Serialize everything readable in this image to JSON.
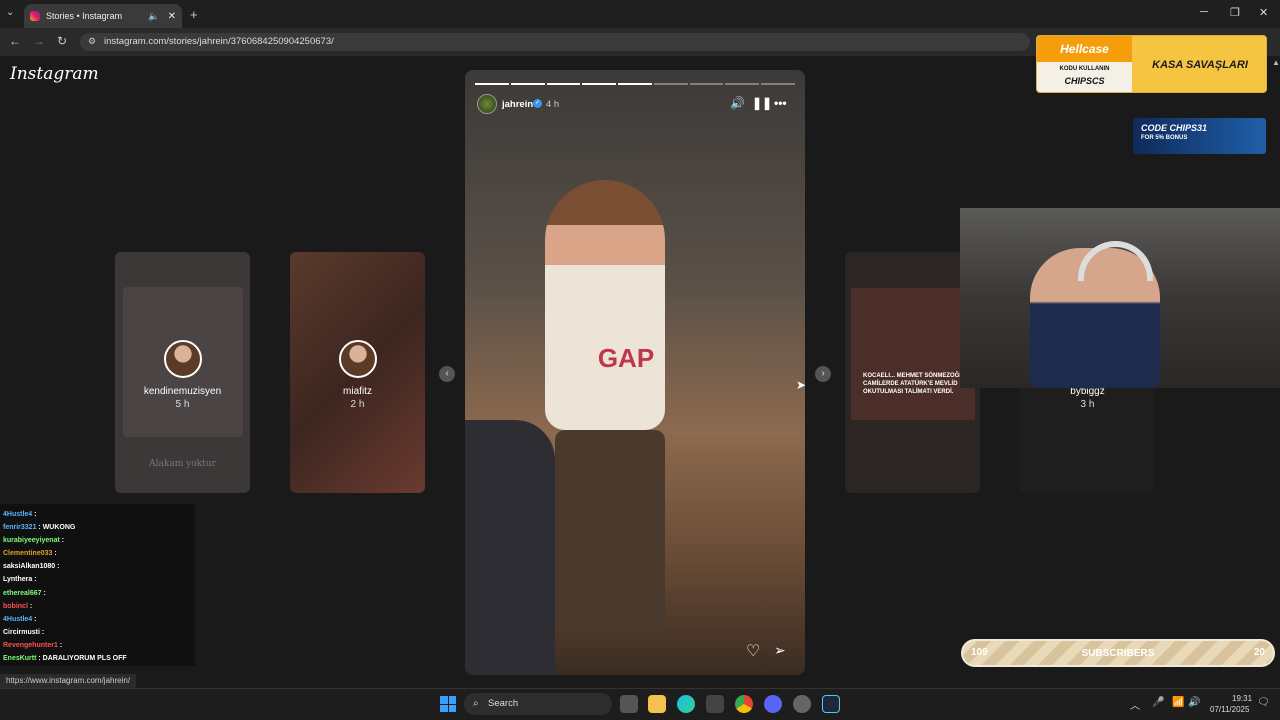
{
  "browser": {
    "tab_title": "Stories • Instagram",
    "url": "instagram.com/stories/jahrein/3760684250904250673/",
    "status_url": "https://www.instagram.com/jahrein/"
  },
  "instagram": {
    "logo": "Instagram",
    "side_stories": [
      {
        "user": "kendinemuzisyen",
        "time": "5 h",
        "caption": "Alakam yoktur"
      },
      {
        "user": "miafitz",
        "time": "2 h"
      },
      {
        "user": "",
        "time": "",
        "caption": "KOCAELI... MEHMET SÖNMEZOĞLU CAMİLERDE ATATÜRK'E MEVLİD OKUTULMASI TALİMATI VERDİ."
      },
      {
        "user": "bybiggz",
        "time": "3 h"
      }
    ],
    "story": {
      "user": "jahrein",
      "time": "4 h",
      "progress_segments": 9,
      "progress_done": 5
    }
  },
  "overlays": {
    "hellcase": {
      "brand": "Hellcase",
      "code_line1": "KODU KULLANIN",
      "code_line2": "CHIPSCS",
      "right": "KASA SAVAŞLARI"
    },
    "lootbox": {
      "code": "CODE CHIPS31",
      "bonus": "FOR 5% BONUS"
    },
    "subscribers": {
      "left": "109",
      "label": "SUBSCRIBERS",
      "right": "20"
    }
  },
  "chat": [
    {
      "user": "4Hustle4",
      "msg": ":",
      "color": "#5ab4ff"
    },
    {
      "user": "fenrir3321",
      "msg": ": WUKONG",
      "color": "#5ab4ff"
    },
    {
      "user": "kurabiyeeyiyenat",
      "msg": ":",
      "color": "#7cfc7c"
    },
    {
      "user": "Clementine033",
      "msg": ":",
      "color": "#e0a030"
    },
    {
      "user": "saksiAlkan1080",
      "msg": ":",
      "color": "#ffffff"
    },
    {
      "user": "Lynthera",
      "msg": ":",
      "color": "#ffffff"
    },
    {
      "user": "ethereal667",
      "msg": ":",
      "color": "#7cfc7c"
    },
    {
      "user": "bobincl",
      "msg": ":",
      "color": "#ff5050"
    },
    {
      "user": "4Hustle4",
      "msg": ":",
      "color": "#5ab4ff"
    },
    {
      "user": "Circirmusti",
      "msg": ":",
      "color": "#ffffff"
    },
    {
      "user": "Revengehunter1",
      "msg": ":",
      "color": "#ff5050"
    },
    {
      "user": "EnesKurtt",
      "msg": ": DARALIYORUM PLS OFF",
      "color": "#7cfc7c"
    }
  ],
  "taskbar": {
    "search": "Search",
    "time": "19:31",
    "date": "07/11/2025"
  }
}
